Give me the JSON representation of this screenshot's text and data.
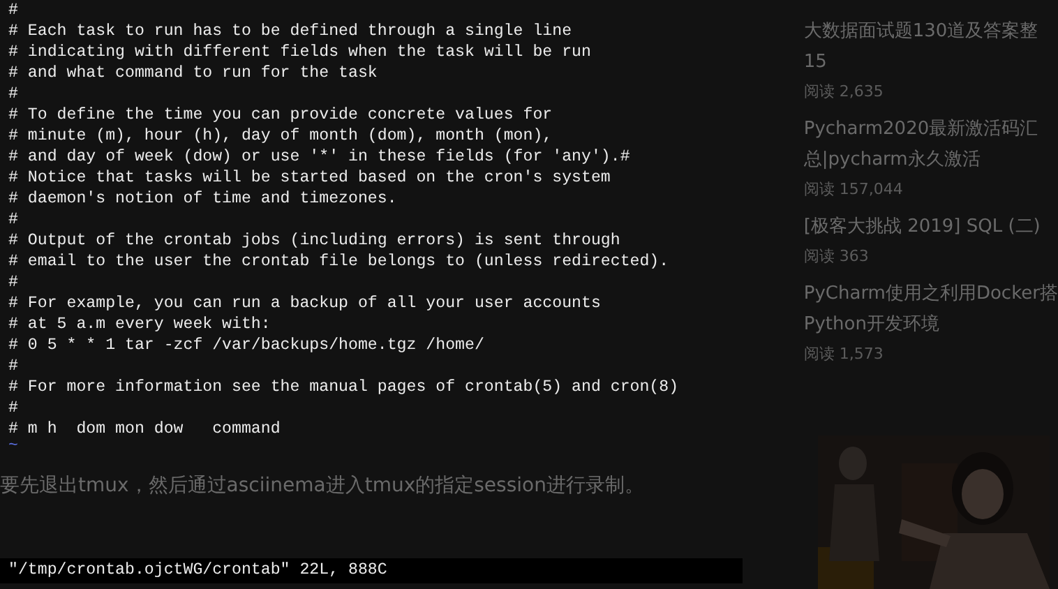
{
  "editor": {
    "lines": [
      "#",
      "# Each task to run has to be defined through a single line",
      "# indicating with different fields when the task will be run",
      "# and what command to run for the task",
      "#",
      "# To define the time you can provide concrete values for",
      "# minute (m), hour (h), day of month (dom), month (mon),",
      "# and day of week (dow) or use '*' in these fields (for 'any').#",
      "# Notice that tasks will be started based on the cron's system",
      "# daemon's notion of time and timezones.",
      "#",
      "# Output of the crontab jobs (including errors) is sent through",
      "# email to the user the crontab file belongs to (unless redirected).",
      "#",
      "# For example, you can run a backup of all your user accounts",
      "# at 5 a.m every week with:",
      "# 0 5 * * 1 tar -zcf /var/backups/home.tgz /home/",
      "#",
      "# For more information see the manual pages of crontab(5) and cron(8)",
      "#",
      "# m h  dom mon dow   command"
    ],
    "empty_line_marker": "~",
    "status_line": "\"/tmp/crontab.ojctWG/crontab\" 22L, 888C"
  },
  "page_paragraph": "要先退出tmux，然后通过asciinema进入tmux的指定session进行录制。",
  "related_articles": [
    {
      "title": "大数据面试题130道及答案整",
      "title_line_2": "15",
      "reads": "阅读 2,635"
    },
    {
      "title": "Pycharm2020最新激活码汇",
      "title_line_2": "总|pycharm永久激活",
      "reads": "阅读 157,044"
    },
    {
      "title": "[极客大挑战 2019] SQL (二)",
      "reads": "阅读 363"
    },
    {
      "title": "PyCharm使用之利用Docker搭",
      "title_line_2": "Python开发环境",
      "reads": "阅读 1,573"
    }
  ]
}
